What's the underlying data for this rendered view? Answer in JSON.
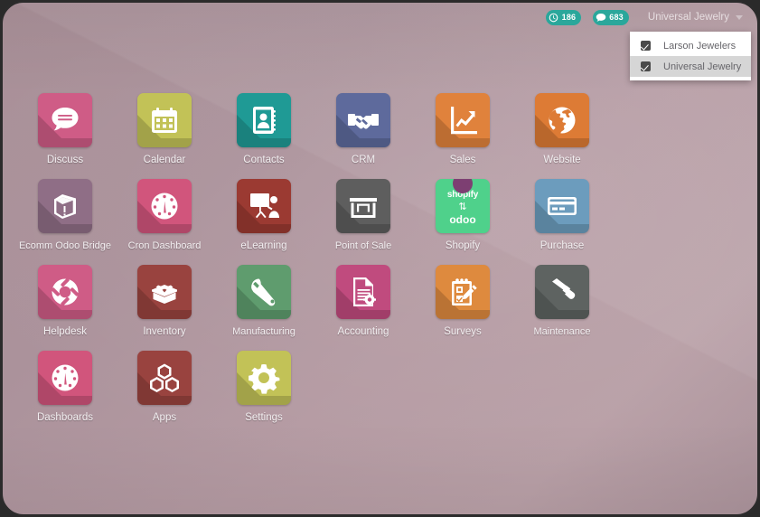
{
  "window": {
    "background_gradient_from": "#a99098",
    "background_gradient_to": "#b9a0a7",
    "border_color": "#2b2b2b"
  },
  "topbar": {
    "badges": [
      {
        "name": "activities-badge",
        "icon": "clock-icon",
        "count": "186",
        "color": "#2aa79b"
      },
      {
        "name": "messages-badge",
        "icon": "chat-bubble-icon",
        "count": "683",
        "color": "#2aa79b"
      }
    ],
    "user_menu": {
      "label": "Universal Jewelry",
      "caret_icon": "chevron-down-icon"
    }
  },
  "dropdown": {
    "open": true,
    "items": [
      {
        "label": "Larson Jewelers",
        "checked": true,
        "selected": false
      },
      {
        "label": "Universal Jewelry",
        "checked": true,
        "selected": true
      }
    ]
  },
  "apps": [
    {
      "label": "Discuss",
      "icon": "discuss-chat-icon",
      "color": "#cf5c86"
    },
    {
      "label": "Calendar",
      "icon": "calendar-icon",
      "color": "#c2c257"
    },
    {
      "label": "Contacts",
      "icon": "contacts-book-icon",
      "color": "#1f9a95"
    },
    {
      "label": "CRM",
      "icon": "handshake-icon",
      "color": "#5e6a9c"
    },
    {
      "label": "Sales",
      "icon": "chart-arrow-up-icon",
      "color": "#e0823c"
    },
    {
      "label": "Website",
      "icon": "globe-icon",
      "color": "#dd7b35"
    },
    {
      "label": "Ecomm Odoo Bridge",
      "icon": "box-alert-icon",
      "color": "#8f6e86"
    },
    {
      "label": "Cron Dashboard",
      "icon": "gauge-icon",
      "color": "#d1557c"
    },
    {
      "label": "eLearning",
      "icon": "presentation-icon",
      "color": "#9b3a32"
    },
    {
      "label": "Point of Sale",
      "icon": "storefront-icon",
      "color": "#5e5e5e"
    },
    {
      "label": "Shopify",
      "icon": "shopify-odoo-sync-icon",
      "color": "#4fd18b"
    },
    {
      "label": "Purchase",
      "icon": "credit-card-icon",
      "color": "#6c9cbd"
    },
    {
      "label": "Helpdesk",
      "icon": "lifebuoy-icon",
      "color": "#cf5c86"
    },
    {
      "label": "Inventory",
      "icon": "open-box-icon",
      "color": "#99433f"
    },
    {
      "label": "Manufacturing",
      "icon": "wrench-icon",
      "color": "#5f9c6e"
    },
    {
      "label": "Accounting",
      "icon": "document-gear-icon",
      "color": "#c04b7e"
    },
    {
      "label": "Surveys",
      "icon": "clipboard-pencil-icon",
      "color": "#de8a3e"
    },
    {
      "label": "Maintenance",
      "icon": "hammer-icon",
      "color": "#5e6361"
    },
    {
      "label": "Dashboards",
      "icon": "gauge-icon",
      "color": "#d1557c"
    },
    {
      "label": "Apps",
      "icon": "cubes-icon",
      "color": "#99433f"
    },
    {
      "label": "Settings",
      "icon": "gear-icon",
      "color": "#c2c257"
    }
  ],
  "shopify_tile": {
    "top_word": "shopify",
    "arrows": "⇅",
    "bottom_word": "odoo",
    "drop_color": "#7d3f72"
  }
}
